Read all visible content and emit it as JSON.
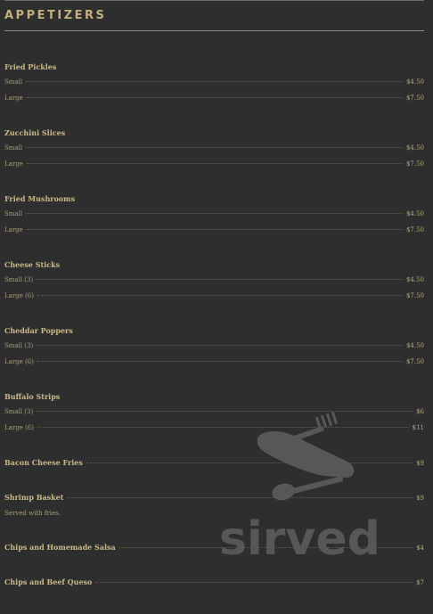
{
  "section": {
    "title": "APPETIZERS"
  },
  "items": [
    {
      "name": "Fried Pickles",
      "rows": [
        {
          "label": "Small",
          "price": "$4.50"
        },
        {
          "label": "Large",
          "price": "$7.50"
        }
      ]
    },
    {
      "name": "Zucchini Slices",
      "rows": [
        {
          "label": "Small",
          "price": "$4.50"
        },
        {
          "label": "Large",
          "price": "$7.50"
        }
      ]
    },
    {
      "name": "Fried Mushrooms",
      "rows": [
        {
          "label": "Small",
          "price": "$4.50"
        },
        {
          "label": "Large",
          "price": "$7.50"
        }
      ]
    },
    {
      "name": "Cheese Sticks",
      "rows": [
        {
          "label": "Small (3)",
          "price": "$4.50"
        },
        {
          "label": "Large (6)",
          "price": "$7.50"
        }
      ]
    },
    {
      "name": "Cheddar Poppers",
      "rows": [
        {
          "label": "Small (3)",
          "price": "$4.50"
        },
        {
          "label": "Large (6)",
          "price": "$7.50"
        }
      ]
    },
    {
      "name": "Buffalo Strips",
      "rows": [
        {
          "label": "Small (3)",
          "price": "$6"
        },
        {
          "label": "Large (6)",
          "price": "$11"
        }
      ]
    }
  ],
  "single_items": [
    {
      "name": "Bacon Cheese Fries",
      "price": "$9"
    },
    {
      "name": "Shrimp Basket",
      "price": "$9",
      "description": "Served with fries."
    },
    {
      "name": "Chips and Homemade Salsa",
      "price": "$4"
    },
    {
      "name": "Chips and Beef Queso",
      "price": "$7"
    }
  ],
  "watermark": {
    "text": "sirved",
    "icon": "utensils-knife-fork-icon",
    "color": "#5a5a5a"
  }
}
